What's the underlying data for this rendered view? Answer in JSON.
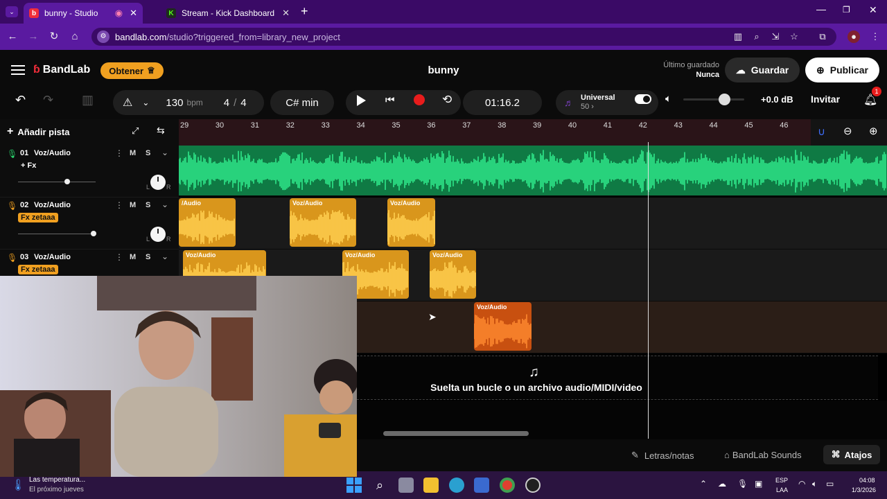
{
  "browser": {
    "tabs": [
      {
        "title": "bunny - Studio",
        "active": true
      },
      {
        "title": "Stream - Kick Dashboard",
        "active": false
      }
    ],
    "url_host": "bandlab.com",
    "url_path": "/studio?triggered_from=library_new_project"
  },
  "header": {
    "logo": "BandLab",
    "obtener": "Obtener",
    "project_title": "bunny",
    "last_saved_label": "Último guardado",
    "last_saved_value": "Nunca",
    "save": "Guardar",
    "publish": "Publicar"
  },
  "toolbar": {
    "tempo": "130",
    "tempo_unit": "bpm",
    "time_sig_num": "4",
    "time_sig_sep": "/",
    "time_sig_den": "4",
    "key": "C# min",
    "time": "01:16.2",
    "instrument_name": "Universal",
    "instrument_value": "50",
    "volume_db": "+0.0 dB",
    "invite": "Invitar",
    "notification_count": "1",
    "add_track": "Añadir pista"
  },
  "ruler": [
    "29",
    "30",
    "31",
    "32",
    "33",
    "34",
    "35",
    "36",
    "37",
    "38",
    "39",
    "40",
    "41",
    "42",
    "43",
    "44",
    "45",
    "46"
  ],
  "tracks": [
    {
      "num": "01",
      "name": "Voz/Audio",
      "fx": "+ Fx",
      "m": "M",
      "s": "S",
      "l": "L",
      "r": "R"
    },
    {
      "num": "02",
      "name": "Voz/Audio",
      "fx": "Fx zetaaa",
      "m": "M",
      "s": "S",
      "l": "L",
      "r": "R"
    },
    {
      "num": "03",
      "name": "Voz/Audio",
      "fx": "Fx zetaaa",
      "m": "M",
      "s": "S"
    }
  ],
  "clips": {
    "label": "Voz/Audio",
    "label_cut": "/Audio"
  },
  "dropzone": "Suelta un bucle o un archivo audio/MIDI/video",
  "bottom": {
    "lyrics": "Letras/notas",
    "sounds": "BandLab Sounds",
    "shortcuts": "Atajos"
  },
  "taskbar": {
    "weather_title": "Las temperatura...",
    "weather_sub": "El próximo jueves",
    "lang1": "ESP",
    "lang2": "LAA",
    "time": "04:08",
    "date": "1/3/2026"
  },
  "colors": {
    "green": "#1ec96b",
    "orange_clip": "#e8a020",
    "red_clip": "#e85a10",
    "accent": "#f0a020"
  }
}
